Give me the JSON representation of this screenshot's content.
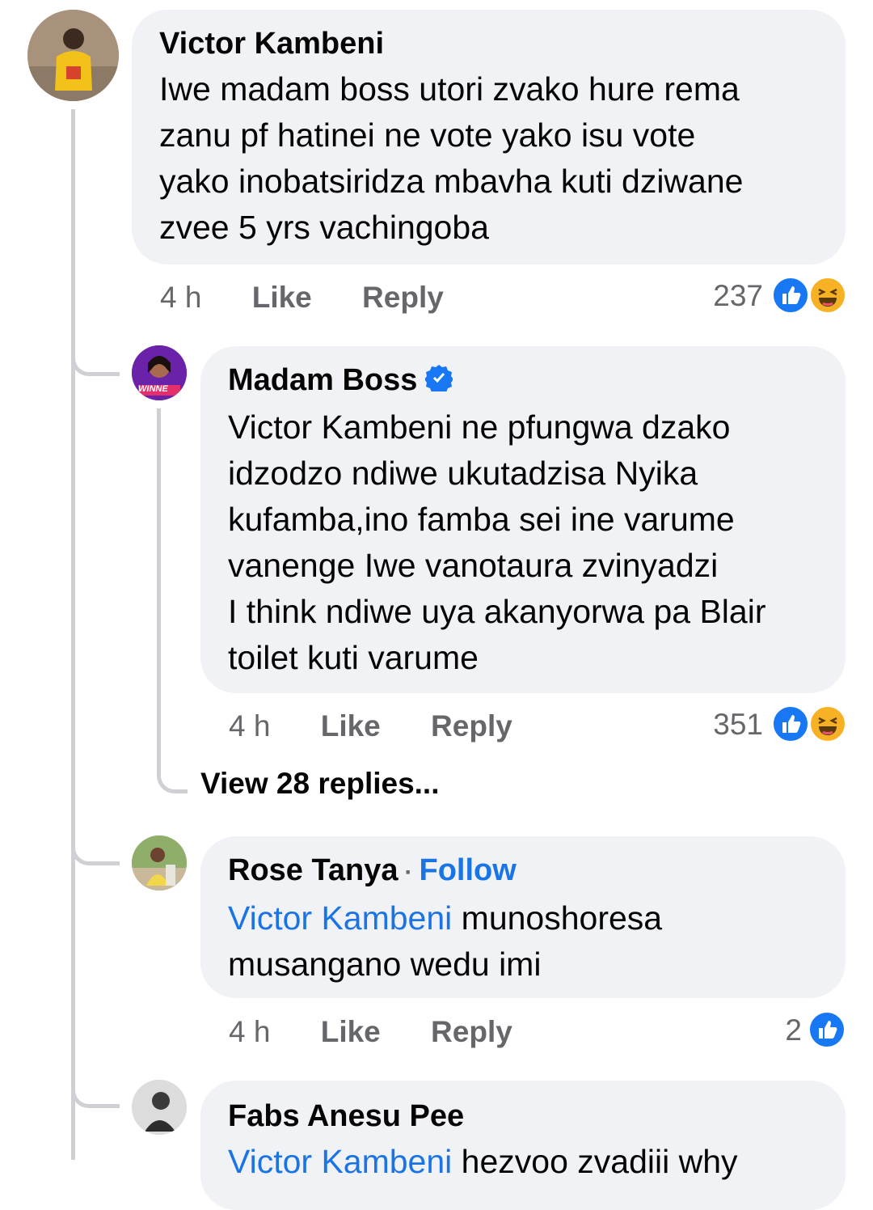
{
  "comments": [
    {
      "author": "Victor Kambeni",
      "lines": [
        "Iwe madam boss utori zvako hure rema",
        "zanu pf hatinei ne vote yako isu vote",
        "yako inobatsiridza mbavha kuti dziwane",
        "zvee 5 yrs vachingoba"
      ],
      "time": "4 h",
      "like": "Like",
      "reply": "Reply",
      "reaction_count": "237",
      "reactions": [
        "like-icon",
        "haha-icon"
      ]
    },
    {
      "author": "Madam Boss",
      "verified": true,
      "lines": [
        "Victor Kambeni ne pfungwa dzako",
        "idzodzo ndiwe ukutadzisa Nyika",
        "kufamba,ino famba sei ine varume",
        "vanenge Iwe vanotaura zvinyadzi",
        "I think ndiwe uya akanyorwa pa Blair",
        "toilet kuti varume"
      ],
      "time": "4 h",
      "like": "Like",
      "reply": "Reply",
      "reaction_count": "351",
      "reactions": [
        "like-icon",
        "haha-icon"
      ],
      "avatar_text": "WINNE",
      "view_replies": "View 28 replies..."
    },
    {
      "author": "Rose Tanya",
      "follow": "Follow",
      "mention": "Victor Kambeni",
      "text_after_mention": " munoshoresa",
      "line2": "musangano wedu imi",
      "time": "4 h",
      "like": "Like",
      "reply": "Reply",
      "reaction_count": "2",
      "reactions": [
        "like-icon"
      ]
    },
    {
      "author": "Fabs Anesu Pee",
      "mention": "Victor Kambeni",
      "text_after_mention": " hezvoo zvadiii why"
    }
  ],
  "colors": {
    "bubble": "#f0f2f5",
    "link": "#1b74e4",
    "meta": "#65676b",
    "like": "#1877f2",
    "haha": "#f7b125"
  }
}
